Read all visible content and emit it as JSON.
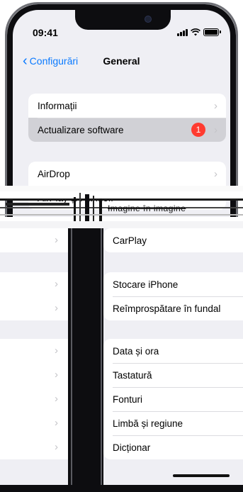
{
  "status_bar": {
    "time": "09:41"
  },
  "nav": {
    "back_label": "Configurări",
    "title": "General"
  },
  "group_about": {
    "items": [
      {
        "label": "Informații"
      },
      {
        "label": "Actualizare software",
        "badge": "1"
      }
    ]
  },
  "group_airdrop": {
    "items": [
      {
        "label": "AirDrop"
      },
      {
        "label": "AirPlay și Handoff"
      }
    ]
  },
  "glitch_text": "Imagine în imagine",
  "right_list": {
    "group1": [
      {
        "label": "CarPlay"
      }
    ],
    "group2": [
      {
        "label": "Stocare iPhone"
      },
      {
        "label": "Reîmprospătare în fundal"
      }
    ],
    "group3": [
      {
        "label": "Data și ora"
      },
      {
        "label": "Tastatură"
      },
      {
        "label": "Fonturi"
      },
      {
        "label": "Limbă și regiune"
      },
      {
        "label": "Dicționar"
      }
    ]
  },
  "colors": {
    "accent": "#0a7aff",
    "badge": "#ff3b30",
    "background": "#efeff4"
  },
  "icons": [
    "chevron-left-icon",
    "chevron-right-icon",
    "signal-icon",
    "wifi-icon",
    "battery-icon"
  ]
}
